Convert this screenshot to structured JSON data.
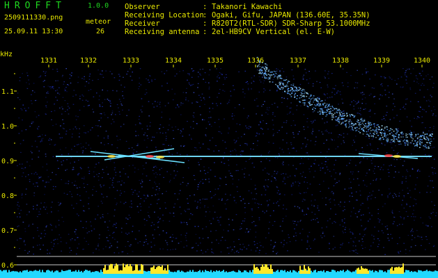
{
  "app": {
    "name": "HROFFT",
    "version": "1.0.0"
  },
  "file": {
    "name": "2509111330.png",
    "datetime": "25.09.11 13:30"
  },
  "meteor": {
    "label": "meteor",
    "count": "26"
  },
  "info": [
    {
      "key": "Observer",
      "value": "Takanori Kawachi"
    },
    {
      "key": "Receiving Location",
      "value": "Ogaki, Gifu, JAPAN (136.60E, 35.35N)"
    },
    {
      "key": "Receiver",
      "value": "R820T2(RTL-SDR) SDR-Sharp 53.1000MHz"
    },
    {
      "key": "Receiving antenna",
      "value": "2el-HB9CV Vertical (el. E-W)"
    }
  ],
  "axis": {
    "unit": "kHz",
    "x_ticks": [
      "1331",
      "1332",
      "1333",
      "1334",
      "1335",
      "1336",
      "1337",
      "1338",
      "1339",
      "1340"
    ],
    "y_ticks": [
      "1.1",
      "1.0",
      "0.9",
      "0.8",
      "0.7",
      "0.6"
    ]
  },
  "colors": {
    "title_green": "#1fd81f",
    "text_yellow": "#e8e800",
    "background": "#000000",
    "noise_blue": "#1a2aa0",
    "carrier": "#40d0ff"
  }
}
